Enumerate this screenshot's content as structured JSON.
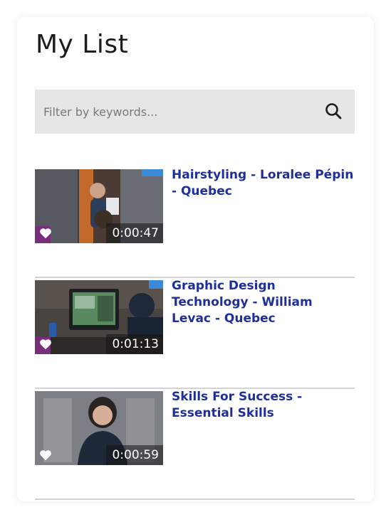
{
  "page": {
    "title": "My List"
  },
  "search": {
    "placeholder": "Filter by keywords...",
    "value": ""
  },
  "colors": {
    "link": "#1f2f9a",
    "search_bg": "#e6e6e6",
    "divider": "#d4d4d4"
  },
  "items": [
    {
      "title": "Hairstyling - Loralee Pépin - Quebec",
      "duration": "0:00:47",
      "favorite": true,
      "icon": "heart-icon"
    },
    {
      "title": "Graphic Design Technology - William Levac - Quebec",
      "duration": "0:01:13",
      "favorite": true,
      "icon": "heart-icon"
    },
    {
      "title": "Skills For Success - Essential Skills",
      "duration": "0:00:59",
      "favorite": true,
      "icon": "heart-icon"
    }
  ]
}
